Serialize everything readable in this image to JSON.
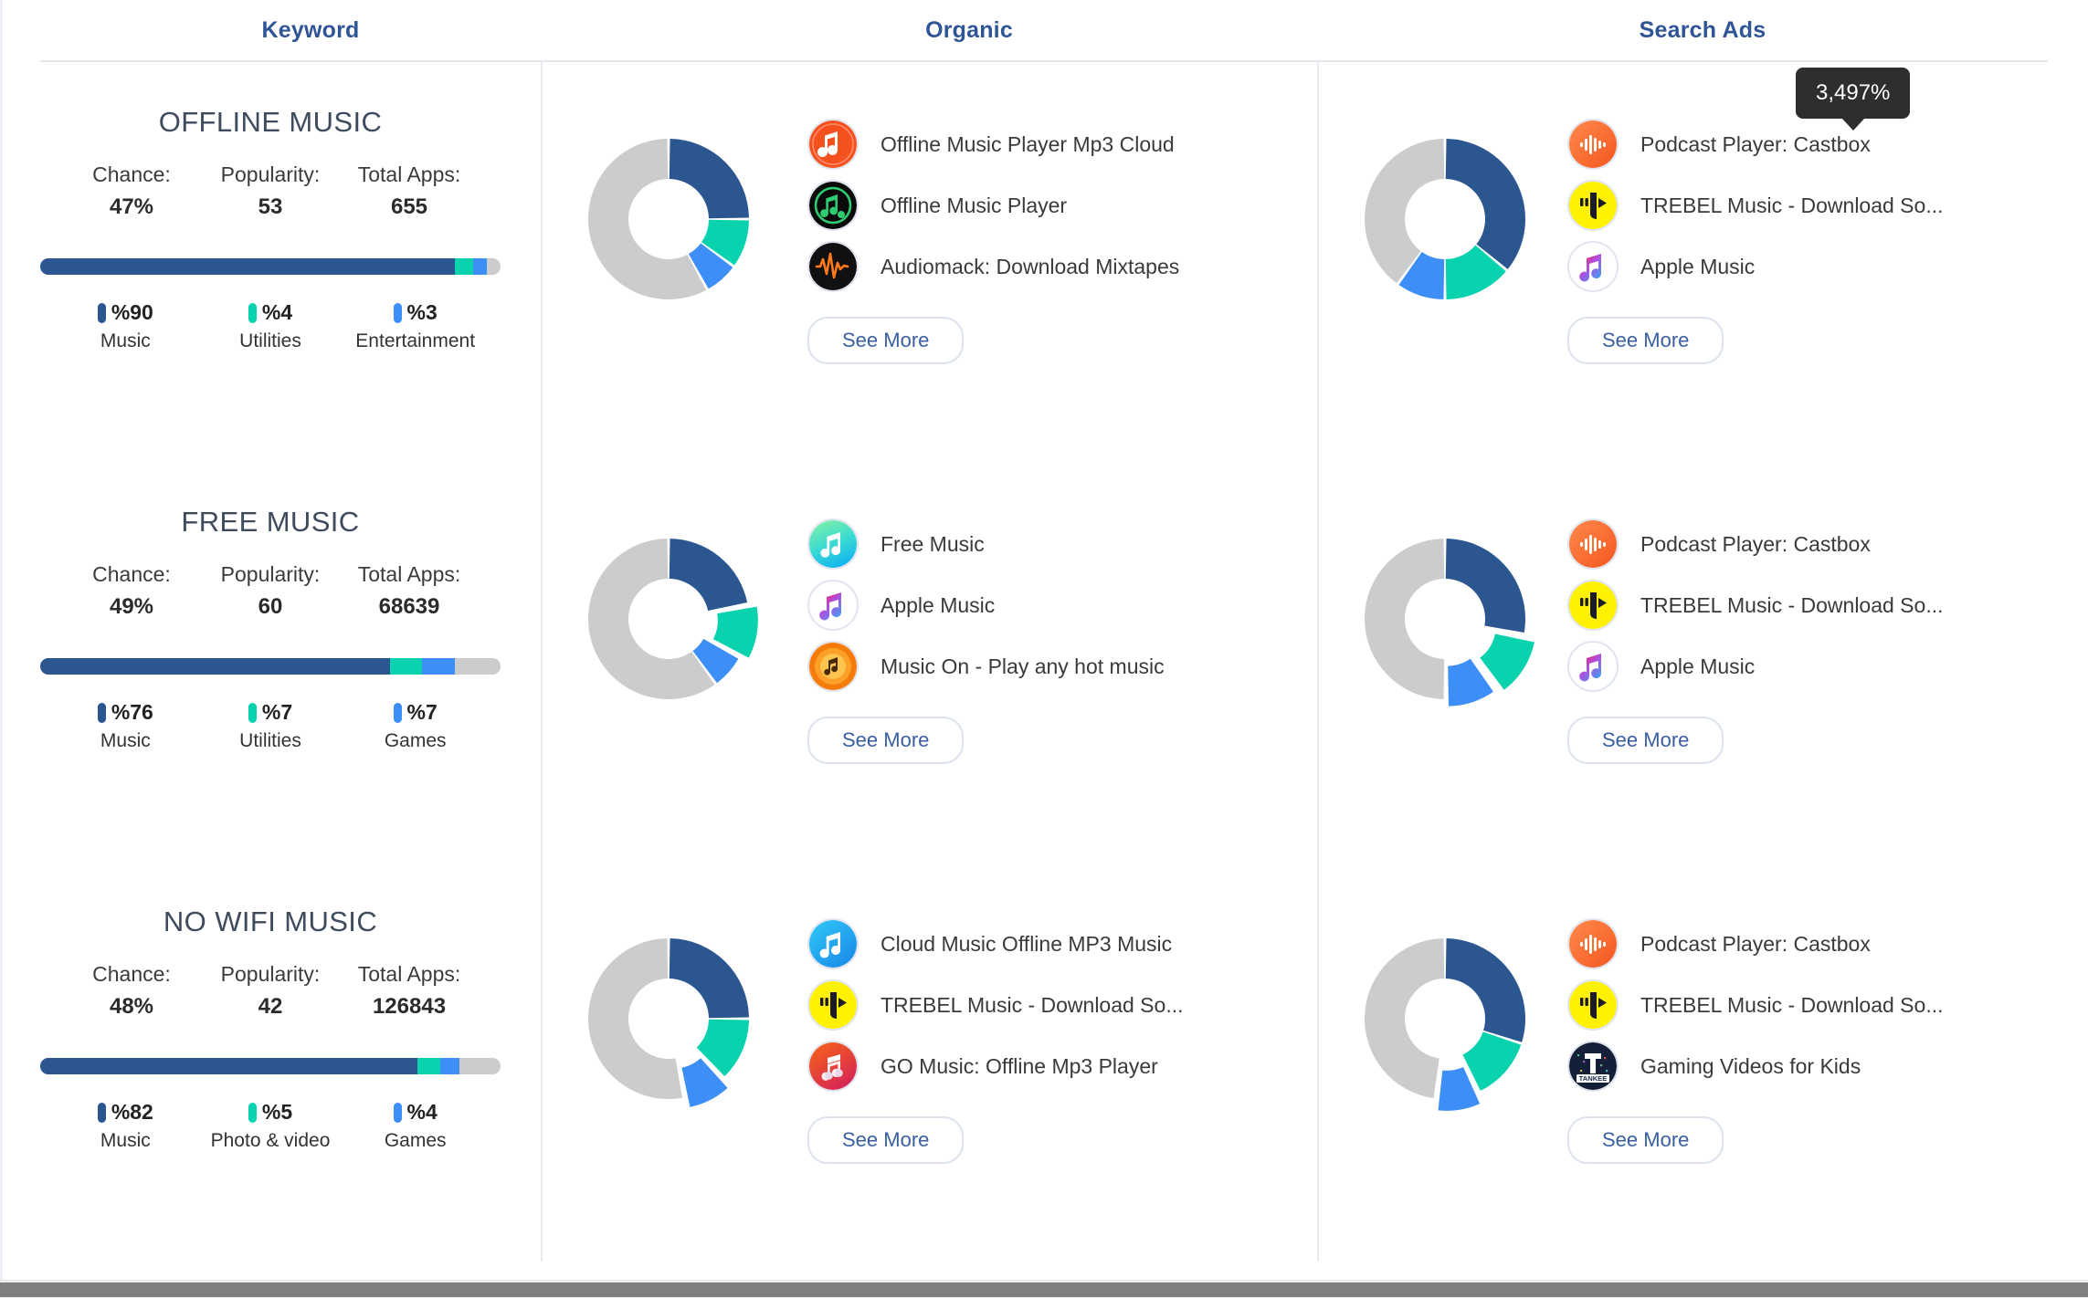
{
  "columns": {
    "keyword": "Keyword",
    "organic": "Organic",
    "search_ads": "Search Ads"
  },
  "tooltip": {
    "value": "3,497%"
  },
  "labels": {
    "chance": "Chance:",
    "popularity": "Popularity:",
    "total_apps": "Total Apps:",
    "see_more": "See More"
  },
  "colors": {
    "primary": "#2b5690",
    "teal": "#09d2ae",
    "blue": "#3d8ef7",
    "grey": "#cbcccd",
    "link": "#2f5596",
    "tooltip_bg": "#2e2e2e"
  },
  "rows": [
    {
      "keyword": {
        "title": "OFFLINE MUSIC",
        "chance": "47%",
        "popularity": "53",
        "total_apps": "655",
        "bar": [
          {
            "pct": 90,
            "color": "#2b5690"
          },
          {
            "pct": 4,
            "color": "#09d2ae"
          },
          {
            "pct": 3,
            "color": "#3d8ef7"
          },
          {
            "pct": 3,
            "color": "#cbcccd"
          }
        ],
        "legend": [
          {
            "pct": "%90",
            "category": "Music",
            "color": "#2b5690"
          },
          {
            "pct": "%4",
            "category": "Utilities",
            "color": "#09d2ae"
          },
          {
            "pct": "%3",
            "category": "Entertainment",
            "color": "#3d8ef7"
          }
        ]
      },
      "organic": {
        "donut": [
          {
            "value": 25,
            "color": "#2b5690",
            "explode": 0
          },
          {
            "value": 10,
            "color": "#09d2ae",
            "explode": 0
          },
          {
            "value": 7,
            "color": "#3d8ef7",
            "explode": 0
          },
          {
            "value": 58,
            "color": "#cbcccd",
            "explode": 0
          }
        ],
        "apps": [
          {
            "name": "Offline Music Player Mp3 Cloud",
            "icon": "note-orange-icon"
          },
          {
            "name": "Offline Music Player",
            "icon": "note-black-green-icon"
          },
          {
            "name": "Audiomack: Download Mixtapes",
            "icon": "waveform-black-icon"
          }
        ]
      },
      "ads": {
        "donut": [
          {
            "value": 36,
            "color": "#2b5690",
            "explode": 0
          },
          {
            "value": 14,
            "color": "#09d2ae",
            "explode": 0
          },
          {
            "value": 10,
            "color": "#3d8ef7",
            "explode": 0
          },
          {
            "value": 40,
            "color": "#cbcccd",
            "explode": 0
          }
        ],
        "apps": [
          {
            "name": "Podcast Player: Castbox",
            "icon": "castbox-icon"
          },
          {
            "name": "TREBEL Music - Download So...",
            "icon": "trebel-icon"
          },
          {
            "name": "Apple Music",
            "icon": "apple-music-icon"
          }
        ]
      }
    },
    {
      "keyword": {
        "title": "FREE MUSIC",
        "chance": "49%",
        "popularity": "60",
        "total_apps": "68639",
        "bar": [
          {
            "pct": 76,
            "color": "#2b5690"
          },
          {
            "pct": 7,
            "color": "#09d2ae"
          },
          {
            "pct": 7,
            "color": "#3d8ef7"
          },
          {
            "pct": 10,
            "color": "#cbcccd"
          }
        ],
        "legend": [
          {
            "pct": "%76",
            "category": "Music",
            "color": "#2b5690"
          },
          {
            "pct": "%7",
            "category": "Utilities",
            "color": "#09d2ae"
          },
          {
            "pct": "%7",
            "category": "Games",
            "color": "#3d8ef7"
          }
        ]
      },
      "organic": {
        "donut": [
          {
            "value": 22,
            "color": "#2b5690",
            "explode": 0
          },
          {
            "value": 11,
            "color": "#09d2ae",
            "explode": 10
          },
          {
            "value": 7,
            "color": "#3d8ef7",
            "explode": 0
          },
          {
            "value": 60,
            "color": "#cbcccd",
            "explode": 0
          }
        ],
        "apps": [
          {
            "name": "Free Music",
            "icon": "free-music-icon"
          },
          {
            "name": "Apple Music",
            "icon": "apple-music-icon"
          },
          {
            "name": "Music On - Play any hot music",
            "icon": "music-on-icon"
          }
        ]
      },
      "ads": {
        "donut": [
          {
            "value": 28,
            "color": "#2b5690",
            "explode": 0
          },
          {
            "value": 12,
            "color": "#09d2ae",
            "explode": 14
          },
          {
            "value": 10,
            "color": "#3d8ef7",
            "explode": 8
          },
          {
            "value": 50,
            "color": "#cbcccd",
            "explode": 0
          }
        ],
        "apps": [
          {
            "name": "Podcast Player: Castbox",
            "icon": "castbox-icon"
          },
          {
            "name": "TREBEL Music - Download So...",
            "icon": "trebel-icon"
          },
          {
            "name": "Apple Music",
            "icon": "apple-music-icon"
          }
        ]
      }
    },
    {
      "keyword": {
        "title": "NO WIFI MUSIC",
        "chance": "48%",
        "popularity": "42",
        "total_apps": "126843",
        "bar": [
          {
            "pct": 82,
            "color": "#2b5690"
          },
          {
            "pct": 5,
            "color": "#09d2ae"
          },
          {
            "pct": 4,
            "color": "#3d8ef7"
          },
          {
            "pct": 9,
            "color": "#cbcccd"
          }
        ],
        "legend": [
          {
            "pct": "%82",
            "category": "Music",
            "color": "#2b5690"
          },
          {
            "pct": "%5",
            "category": "Photo & video",
            "color": "#09d2ae"
          },
          {
            "pct": "%4",
            "category": "Games",
            "color": "#3d8ef7"
          }
        ]
      },
      "organic": {
        "donut": [
          {
            "value": 25,
            "color": "#2b5690",
            "explode": 0
          },
          {
            "value": 13,
            "color": "#09d2ae",
            "explode": 0
          },
          {
            "value": 9,
            "color": "#3d8ef7",
            "explode": 12
          },
          {
            "value": 53,
            "color": "#cbcccd",
            "explode": 0
          }
        ],
        "apps": [
          {
            "name": "Cloud Music Offline MP3 Music",
            "icon": "cloud-music-icon"
          },
          {
            "name": "TREBEL Music - Download So...",
            "icon": "trebel-icon"
          },
          {
            "name": "GO Music: Offline Mp3 Player",
            "icon": "go-music-icon"
          }
        ]
      },
      "ads": {
        "donut": [
          {
            "value": 30,
            "color": "#2b5690",
            "explode": 0
          },
          {
            "value": 13,
            "color": "#09d2ae",
            "explode": 0
          },
          {
            "value": 9,
            "color": "#3d8ef7",
            "explode": 13
          },
          {
            "value": 48,
            "color": "#cbcccd",
            "explode": 0
          }
        ],
        "apps": [
          {
            "name": "Podcast Player: Castbox",
            "icon": "castbox-icon"
          },
          {
            "name": "TREBEL Music - Download So...",
            "icon": "trebel-icon"
          },
          {
            "name": "Gaming Videos for Kids",
            "icon": "tankee-icon"
          }
        ]
      }
    }
  ]
}
